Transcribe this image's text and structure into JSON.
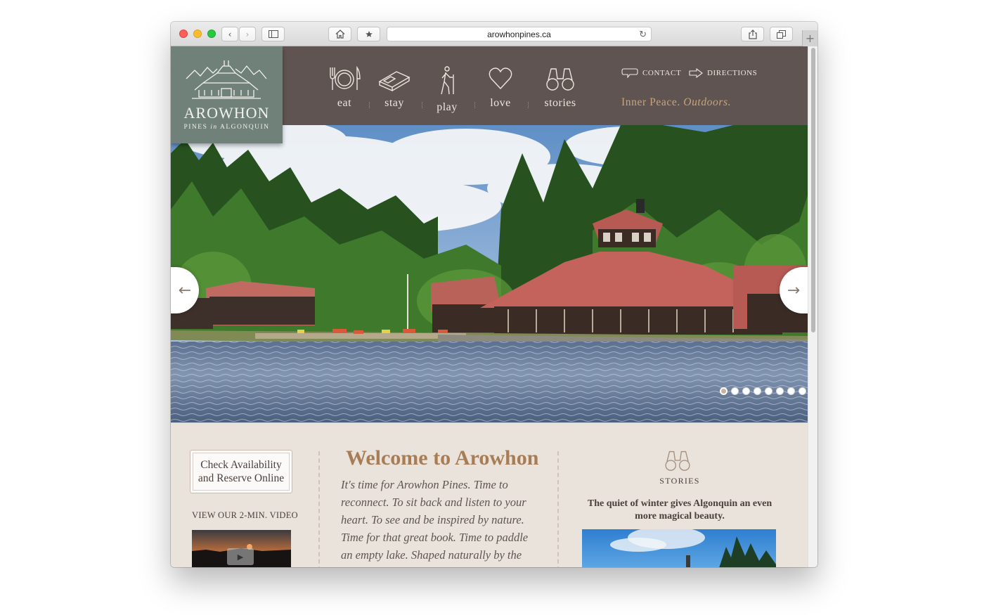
{
  "browser": {
    "url": "arowhonpines.ca",
    "new_tab_label": "+",
    "back_label": "‹",
    "forward_label": "›"
  },
  "site": {
    "logo": {
      "name": "AROWHON",
      "sub_pre": "PINES ",
      "sub_in": "in",
      "sub_post": " ALGONQUIN"
    },
    "nav": [
      {
        "label": "eat",
        "icon": "plate-cutlery-icon"
      },
      {
        "label": "stay",
        "icon": "bed-icon"
      },
      {
        "label": "play",
        "icon": "hiker-icon"
      },
      {
        "label": "love",
        "icon": "heart-icon"
      },
      {
        "label": "stories",
        "icon": "binoculars-icon"
      }
    ],
    "utility": {
      "contact": "CONTACT",
      "directions": "DIRECTIONS"
    },
    "tagline": {
      "plain": "Inner Peace. ",
      "italic": "Outdoors."
    }
  },
  "hero": {
    "prev_label": "←",
    "next_label": "→",
    "slide_count": 8,
    "active_slide": 1
  },
  "content": {
    "reserve_line1": "Check Availability",
    "reserve_line2": "and Reserve Online",
    "video_label": "VIEW OUR 2-MIN. VIDEO",
    "welcome_title": "Welcome to Arowhon",
    "welcome_text": "It's time for Arowhon Pines. Time to reconnect. To sit back and listen to your heart. To see and be inspired by nature. Time for that great book. Time to paddle an empty lake. Shaped naturally by the",
    "stories_label": "STORIES",
    "stories_text": "The quiet of winter gives Algonquin an even more magical beauty."
  },
  "colors": {
    "header_bg": "#5f5451",
    "logo_bg": "#6f8179",
    "accent_gold": "#c8a577",
    "title_brown": "#a87d55",
    "page_bg": "#e9e3dc"
  }
}
